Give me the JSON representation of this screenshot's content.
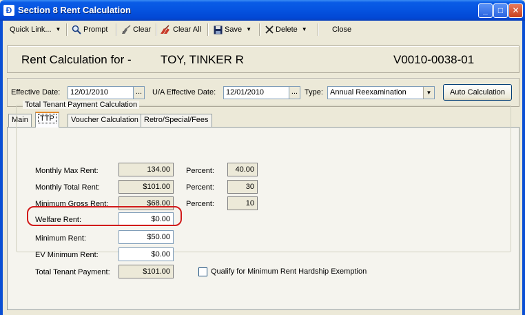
{
  "window": {
    "title": "Section 8 Rent Calculation",
    "app_icon": "app-icon",
    "minimize": "_",
    "maximize": "□",
    "close": "✕"
  },
  "toolbar": {
    "quick_link": "Quick Link...",
    "prompt": "Prompt",
    "clear": "Clear",
    "clear_all": "Clear All",
    "save": "Save",
    "delete": "Delete",
    "close": "Close"
  },
  "header": {
    "label": "Rent Calculation for -",
    "name": "TOY, TINKER R",
    "id": "V0010-0038-01"
  },
  "effective": {
    "effective_date_label": "Effective Date:",
    "effective_date": "12/01/2010",
    "ua_label": "U/A Effective Date:",
    "ua_date": "12/01/2010",
    "type_label": "Type:",
    "type_value": "Annual Reexamination",
    "auto_calc": "Auto Calculation",
    "dots": "..."
  },
  "tabs": [
    {
      "label": "Main"
    },
    {
      "label": "TTP"
    },
    {
      "label": "Voucher Calculation"
    },
    {
      "label": "Retro/Special/Fees"
    }
  ],
  "ttp": {
    "group_title": "Total Tenant Payment Calculation",
    "monthly_max_rent_label": "Monthly Max Rent:",
    "monthly_max_rent": "134.00",
    "monthly_total_rent_label": "Monthly Total Rent:",
    "monthly_total_rent": "$101.00",
    "minimum_gross_rent_label": "Minimum Gross Rent:",
    "minimum_gross_rent": "$68.00",
    "welfare_rent_label": "Welfare Rent:",
    "welfare_rent": "$0.00",
    "minimum_rent_label": "Minimum Rent:",
    "minimum_rent": "$50.00",
    "ev_minimum_rent_label": "EV Minimum Rent:",
    "ev_minimum_rent": "$0.00",
    "total_tenant_payment_label": "Total Tenant Payment:",
    "total_tenant_payment": "$101.00",
    "percent_label": "Percent:",
    "percent_1": "40.00",
    "percent_2": "30",
    "percent_3": "10",
    "hardship_label": "Qualify for Minimum Rent Hardship Exemption"
  },
  "colors": {
    "highlight": "#d11a1a",
    "titlebar": "#0553e0"
  }
}
